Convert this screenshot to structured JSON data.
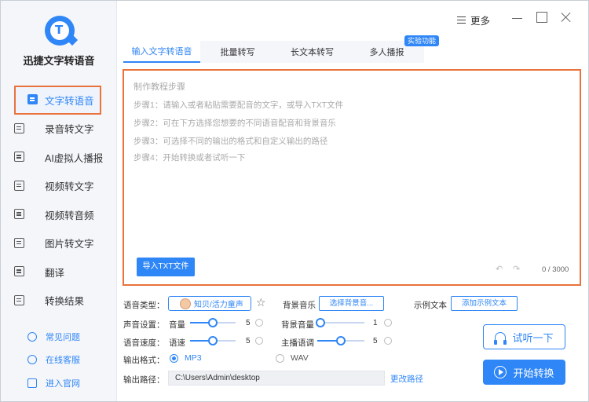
{
  "app": {
    "title": "迅捷文字转语音"
  },
  "titlebar": {
    "more_label": "更多"
  },
  "sidebar": {
    "items": [
      {
        "label": "文字转语音",
        "active": true
      },
      {
        "label": "录音转文字"
      },
      {
        "label": "AI虚拟人播报"
      },
      {
        "label": "视频转文字"
      },
      {
        "label": "视频转音频"
      },
      {
        "label": "图片转文字"
      },
      {
        "label": "翻译"
      },
      {
        "label": "转换结果"
      }
    ],
    "help": [
      {
        "label": "常见问题",
        "icon": "question-icon"
      },
      {
        "label": "在线客服",
        "icon": "headset-icon"
      },
      {
        "label": "进入官网",
        "icon": "monitor-icon"
      }
    ]
  },
  "tabs": [
    {
      "label": "输入文字转语音",
      "active": true
    },
    {
      "label": "批量转写"
    },
    {
      "label": "长文本转写"
    },
    {
      "label": "多人播报",
      "badge": "实验功能"
    }
  ],
  "editor": {
    "title": "制作教程步骤",
    "steps": [
      "步骤1：请输入或者粘贴需要配音的文字，或导入TXT文件",
      "步骤2：可在下方选择您想要的不同语音配音和背景音乐",
      "步骤3：可选择不同的输出的格式和自定义输出的路径",
      "步骤4：开始转换或者试听一下"
    ],
    "import_label": "导入TXT文件",
    "char_count": "0 / 3000"
  },
  "settings": {
    "voice_type_label": "语音类型：",
    "voice_name": "知贝/活力童声",
    "bg_music_label": "背景音乐",
    "bg_music_button": "选择背景音...",
    "sample_text_label": "示例文本",
    "sample_text_button": "添加示例文本",
    "sound_settings_label": "声音设置：",
    "volume_label": "音量",
    "volume_value": "5",
    "volume_level": 0.5,
    "bg_volume_label": "背景音量",
    "bg_volume_value": "1",
    "bg_volume_level": 0.0,
    "speed_section_label": "语音速度：",
    "speed_label": "语速",
    "speed_value": "5",
    "speed_level": 0.5,
    "pitch_label": "主播语调",
    "pitch_value": "5",
    "pitch_level": 0.5,
    "output_format_label": "输出格式：",
    "format_mp3": "MP3",
    "format_wav": "WAV",
    "selected_format": "MP3",
    "output_path_label": "输出路径：",
    "output_path": "C:\\Users\\Admin\\desktop",
    "change_path_label": "更改路径"
  },
  "actions": {
    "listen_label": "试听一下",
    "convert_label": "开始转换"
  },
  "colors": {
    "accent": "#2f86f6",
    "highlight_border": "#e8733d"
  }
}
